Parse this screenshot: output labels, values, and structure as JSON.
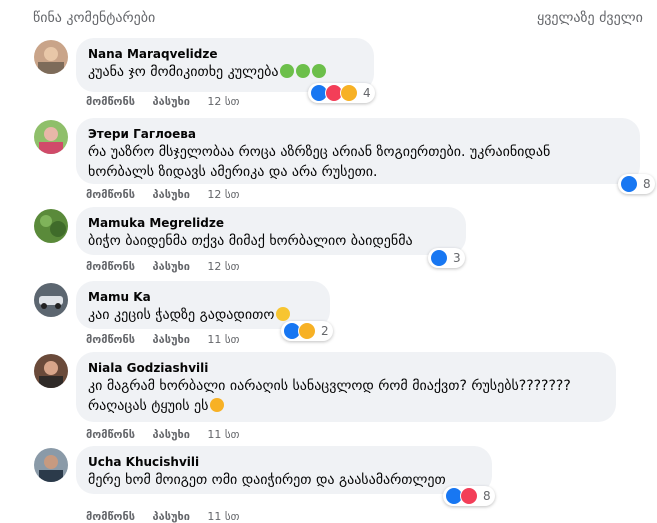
{
  "header": {
    "left_title": "წინა კომენტარები",
    "right_filter": "ყველაზე ძველი"
  },
  "colors": {
    "bubble_bg": "#f0f2f5",
    "like": "#1877f2",
    "love": "#f33e58",
    "haha": "#f7b125",
    "muted_text": "#65676b"
  },
  "actions": {
    "like_label": "მომწონს",
    "reply_label": "პასუხი"
  },
  "comments": [
    {
      "author": "Nana Maraqvelidze",
      "lines": [
        "კუანა ჯო მომიკითხე კულება"
      ],
      "emoji": [
        "nauseated-face",
        "nauseated-face",
        "nauseated-face"
      ],
      "time": "12 სთ",
      "reactions": [
        "like",
        "love",
        "haha"
      ],
      "reaction_count": "4"
    },
    {
      "author": "Этери Гаглоева",
      "lines": [
        "რა უაზრო მსჯელობაა როცა აზრზეც არიან ზოგიერთები. უკრაინიდან",
        "ხორბალს ზიდავს ამერიკა და არა რუსეთი."
      ],
      "time": "12 სთ",
      "reactions": [
        "like"
      ],
      "reaction_count": "8"
    },
    {
      "author": "Mamuka Megrelidze",
      "lines": [
        "ბიჭო ბაიდენმა თქვა მიმაქ ხორბალიო ბაიდენმა"
      ],
      "time": "12 სთ",
      "reactions": [
        "like"
      ],
      "reaction_count": "3"
    },
    {
      "author": "Mamu Ka",
      "lines": [
        "კაი კეცის ჭადზე გადადითო"
      ],
      "emoji": [
        "grinning-sweat"
      ],
      "time": "11 სთ",
      "reactions": [
        "like",
        "haha"
      ],
      "reaction_count": "2"
    },
    {
      "author": "Niala Godziashvili",
      "lines": [
        "კი მაგრამ ხორბალი იარაღის სანაცვლოდ რომ მიაქვთ? რუსებს???????",
        "რაღაცას ტყუის ეს"
      ],
      "emoji_line2": [
        "flushed-face"
      ],
      "time": "11 სთ",
      "reactions": [],
      "reaction_count": ""
    },
    {
      "author": "Ucha Khucishvili",
      "lines": [
        "მერე ხომ მოიგეთ ომი დაიჭირეთ და გაასამართლეთ"
      ],
      "time": "11 სთ",
      "reactions": [
        "like",
        "love"
      ],
      "reaction_count": "8"
    }
  ]
}
